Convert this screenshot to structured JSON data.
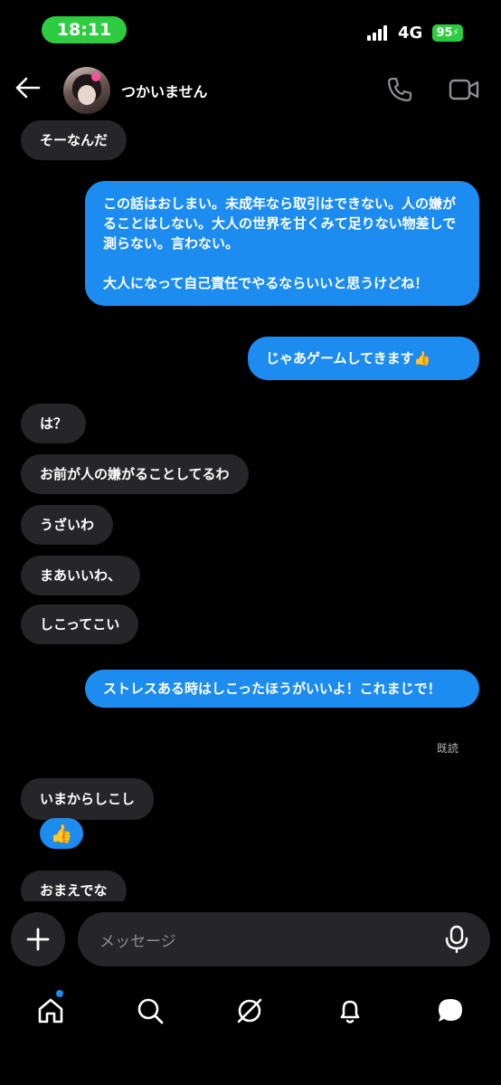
{
  "status_bar": {
    "time": "18:11",
    "network": "4G",
    "battery": "95",
    "battery_color": "#2ecc40"
  },
  "header": {
    "contact_name": "つかいません",
    "icons": [
      "back-arrow-icon",
      "phone-icon",
      "video-camera-icon"
    ]
  },
  "messages": [
    {
      "dir": "received",
      "text": "そーなんだ"
    },
    {
      "dir": "sent",
      "text": "この話はおしまい。未成年なら取引はできない。人の嫌がることはしない。大人の世界を甘くみて足りない物差しで測らない。言わない。\n\n大人になって自己責任でやるならいいと思うけどね！"
    },
    {
      "dir": "sent",
      "text": "じゃあゲームしてきます👍"
    },
    {
      "dir": "received",
      "text": "は？"
    },
    {
      "dir": "received",
      "text": "お前が人の嫌がることしてるわ"
    },
    {
      "dir": "received",
      "text": "うざいわ"
    },
    {
      "dir": "received",
      "text": "まあいいわ、"
    },
    {
      "dir": "received",
      "text": "しこってこい"
    },
    {
      "dir": "sent",
      "text": "ストレスある時はしこったほうがいいよ！これまじで！"
    },
    {
      "dir": "received",
      "text": "いまからしこし"
    },
    {
      "dir": "received",
      "text": "おまえでな"
    }
  ],
  "read_receipt": "既読",
  "reaction": "👍",
  "composer": {
    "placeholder": "メッセージ"
  },
  "nav": [
    "home-icon",
    "search-icon",
    "explore-icon",
    "notifications-icon",
    "messages-icon"
  ],
  "accent_color": "#1c8cf0"
}
